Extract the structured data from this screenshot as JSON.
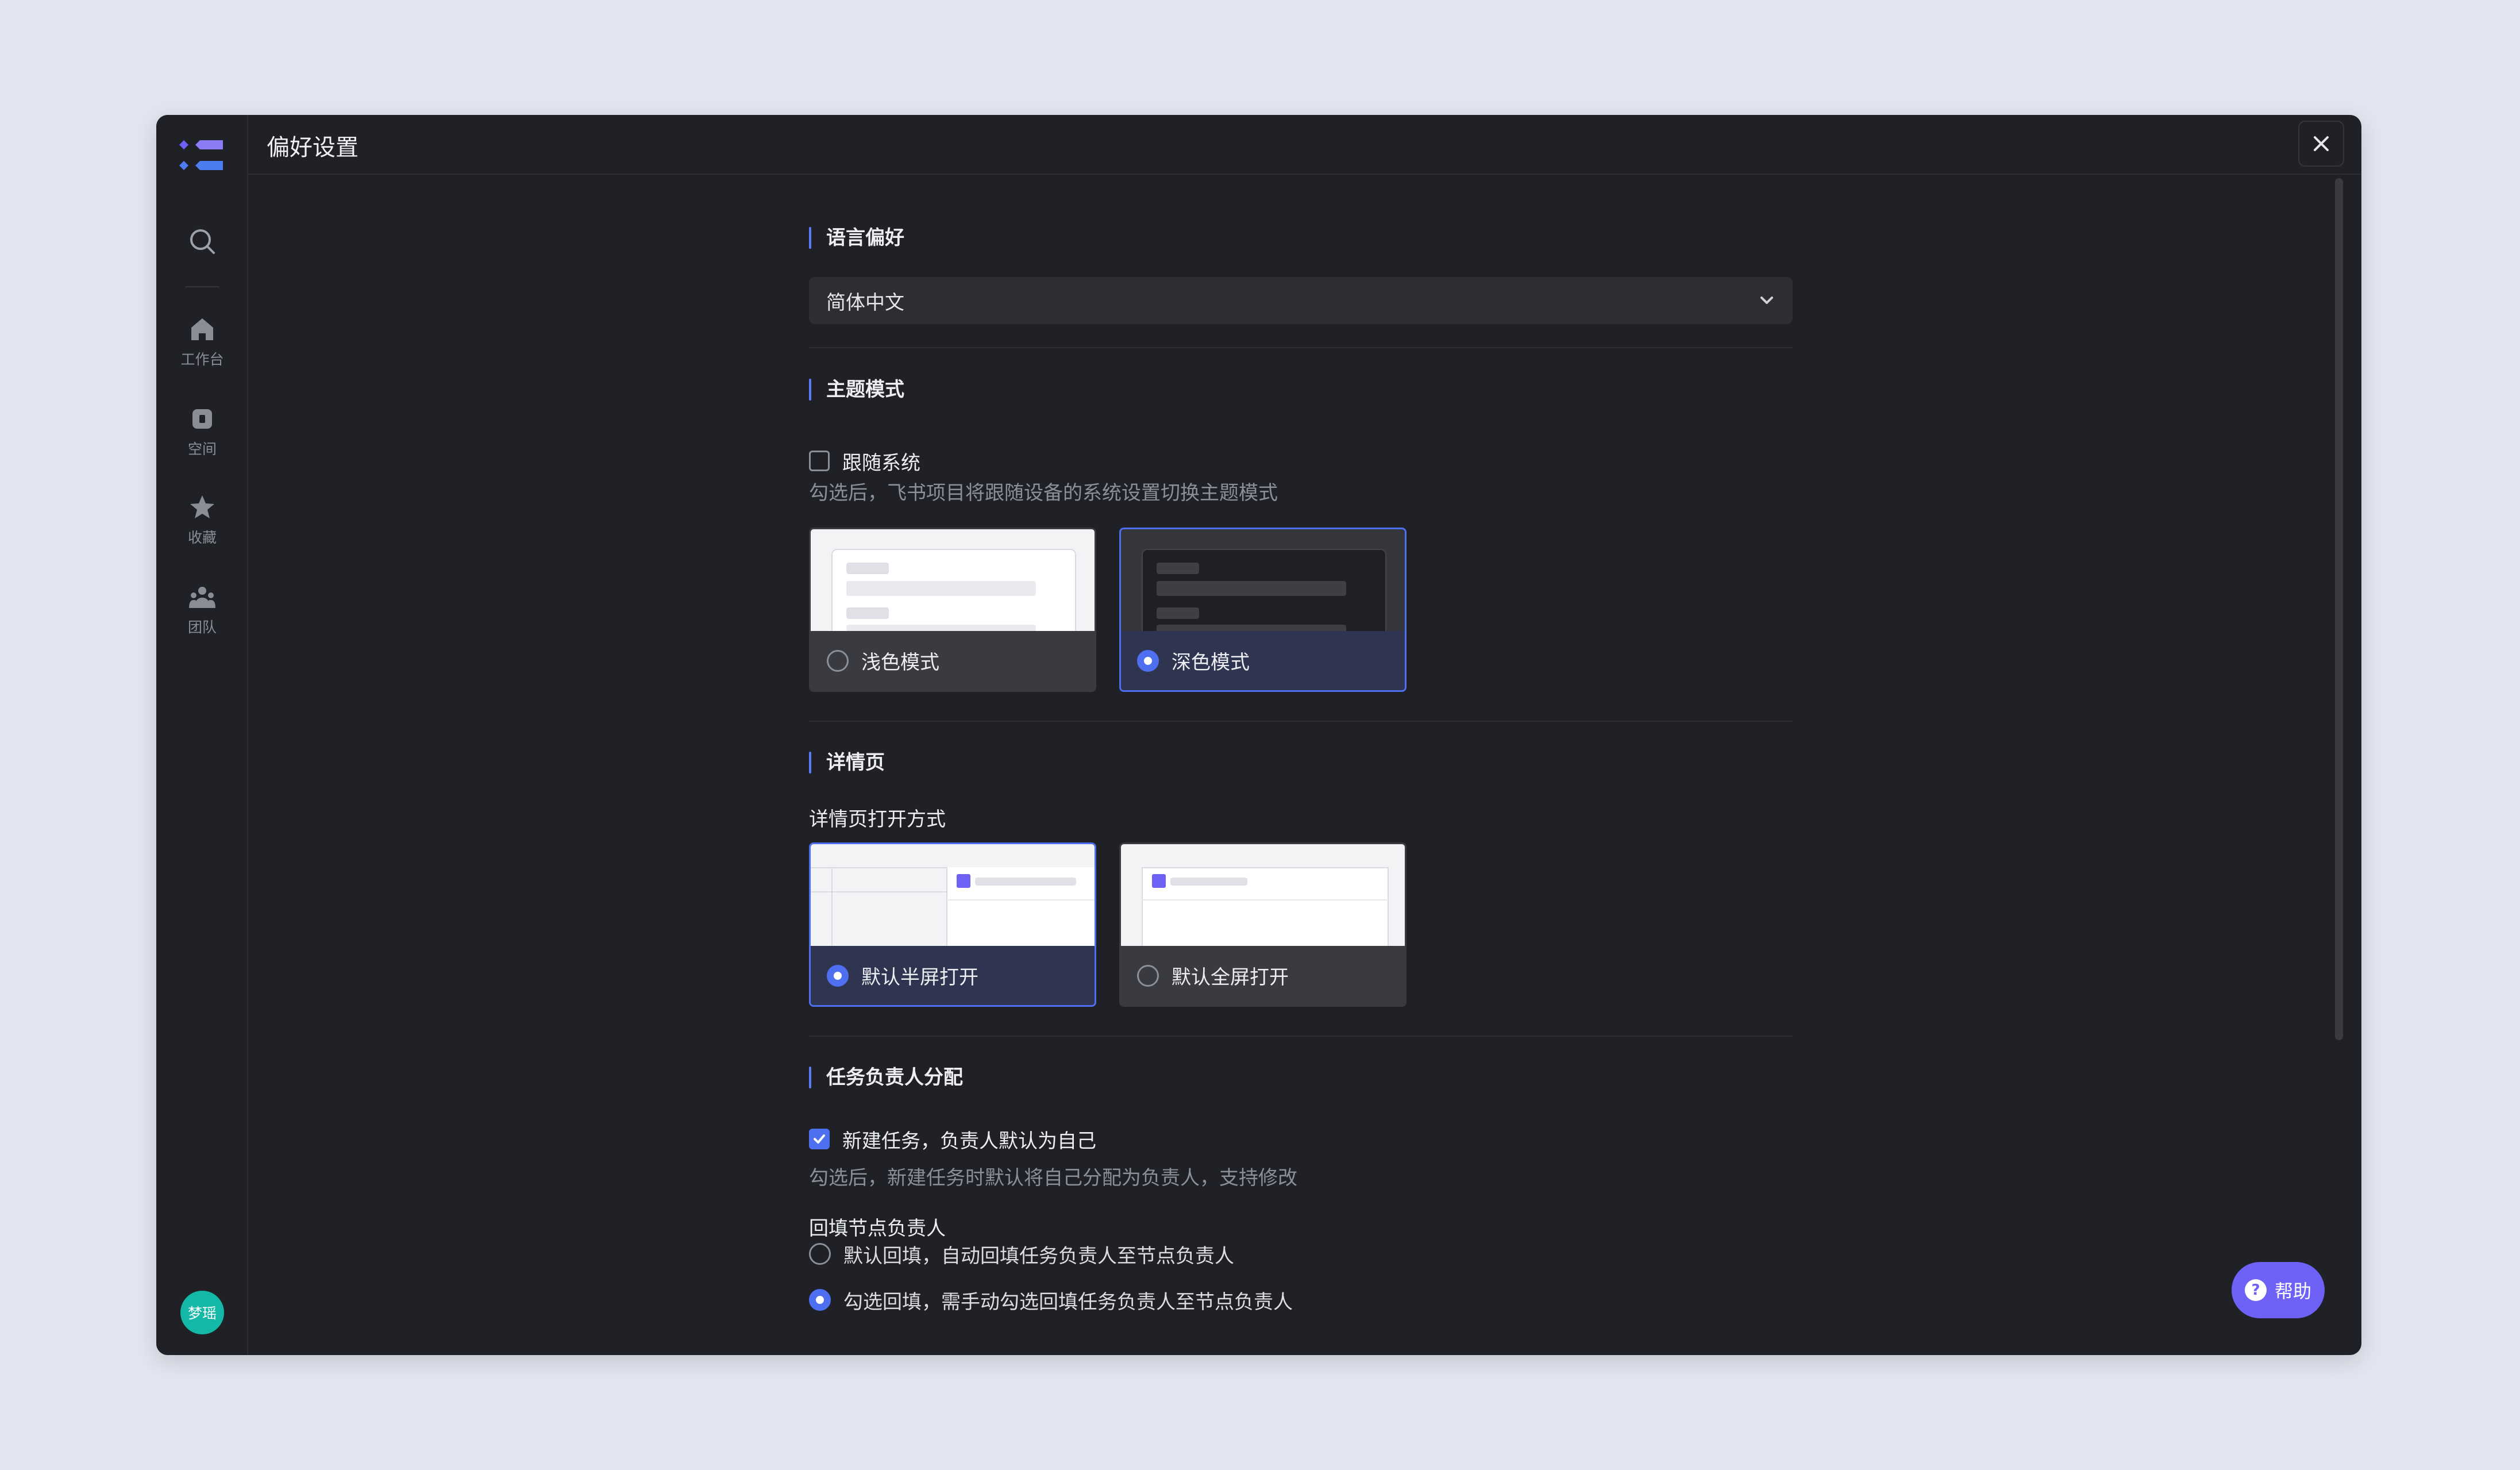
{
  "window": {
    "title": "偏好设置"
  },
  "sidebar": {
    "items": [
      {
        "label": "工作台",
        "icon": "home-icon"
      },
      {
        "label": "空间",
        "icon": "space-icon"
      },
      {
        "label": "收藏",
        "icon": "star-icon"
      },
      {
        "label": "团队",
        "icon": "team-icon"
      }
    ],
    "avatar_text": "梦瑶"
  },
  "language": {
    "section_title": "语言偏好",
    "selected": "简体中文"
  },
  "theme": {
    "section_title": "主题模式",
    "follow_system_label": "跟随系统",
    "follow_system_checked": false,
    "follow_system_hint": "勾选后，飞书项目将跟随设备的系统设置切换主题模式",
    "options": [
      {
        "label": "浅色模式",
        "selected": false
      },
      {
        "label": "深色模式",
        "selected": true
      }
    ]
  },
  "detail": {
    "section_title": "详情页",
    "open_mode_title": "详情页打开方式",
    "options": [
      {
        "label": "默认半屏打开",
        "selected": true
      },
      {
        "label": "默认全屏打开",
        "selected": false
      }
    ]
  },
  "assignee": {
    "section_title": "任务负责人分配",
    "self_default_label": "新建任务，负责人默认为自己",
    "self_default_checked": true,
    "self_default_hint": "勾选后，新建任务时默认将自己分配为负责人，支持修改",
    "backfill_title": "回填节点负责人",
    "backfill_options": [
      {
        "label": "默认回填，自动回填任务负责人至节点负责人",
        "selected": false
      },
      {
        "label": "勾选回填，需手动勾选回填任务负责人至节点负责人",
        "selected": true
      }
    ]
  },
  "help": {
    "label": "帮助",
    "icon_text": "?"
  },
  "colors": {
    "accent": "#4d6ff0",
    "help": "#6d62f5",
    "avatar": "#14b8a6",
    "background": "#202126"
  }
}
